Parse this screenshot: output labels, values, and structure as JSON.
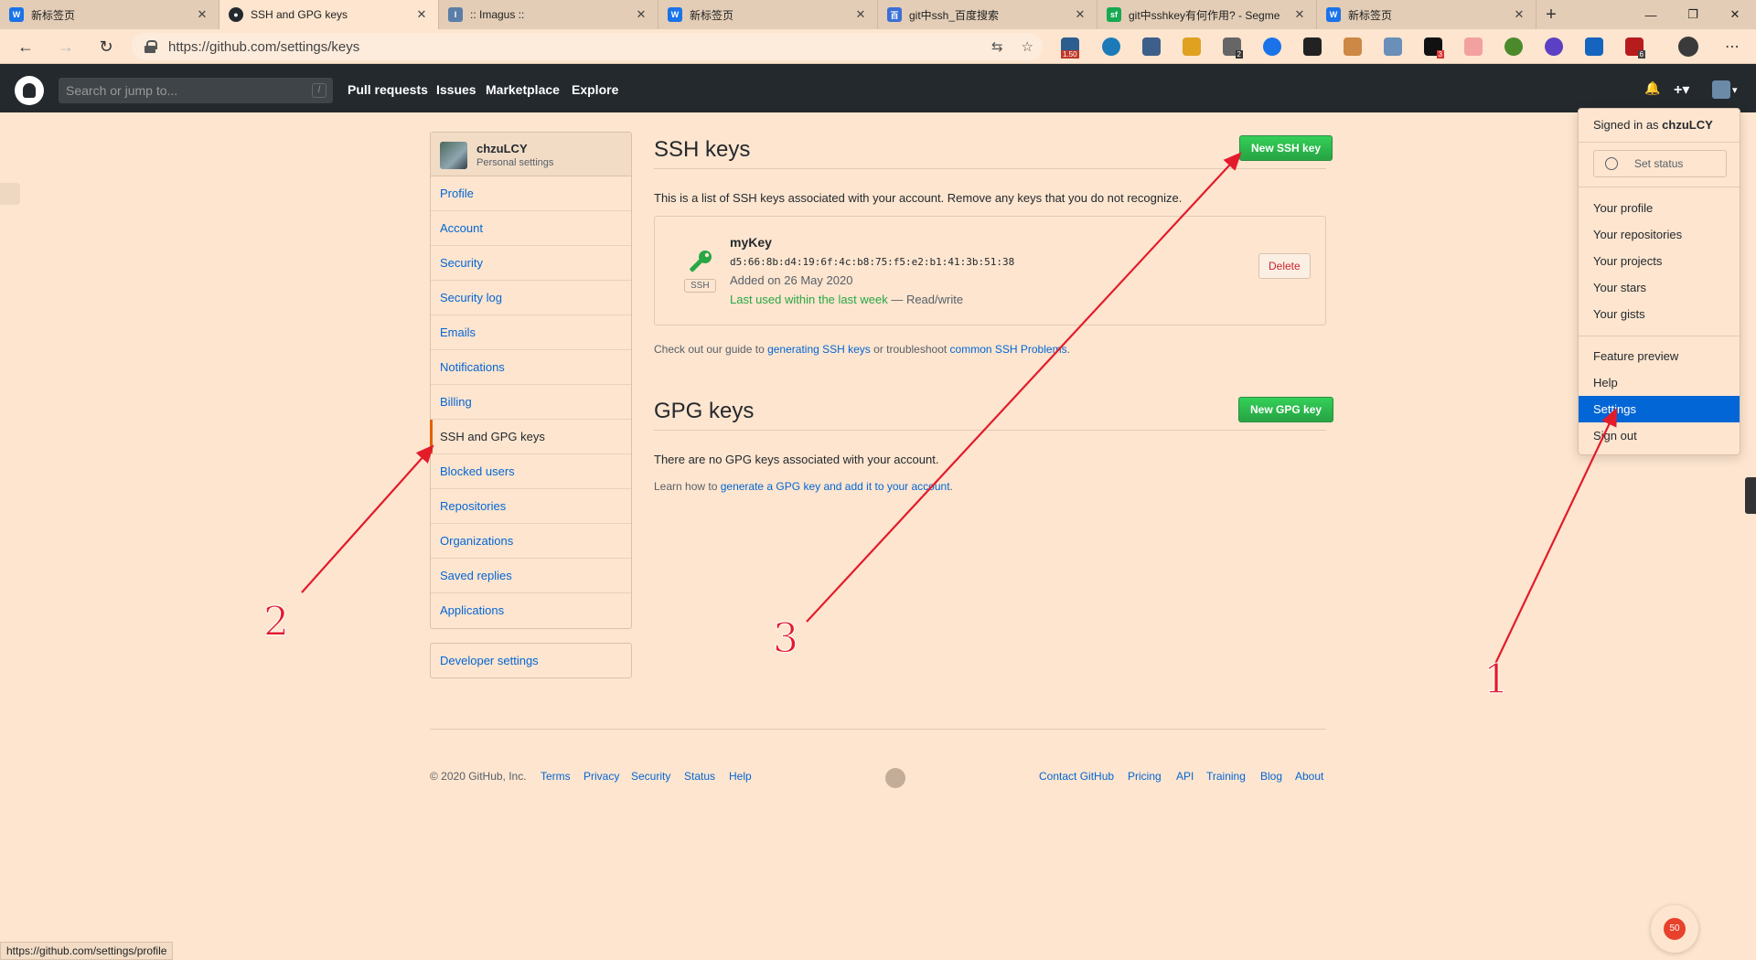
{
  "browser": {
    "tabs": [
      {
        "title": "新标签页",
        "icon_color": "#1a73e8",
        "icon_text": "W"
      },
      {
        "title": "SSH and GPG keys",
        "icon_color": "#24292e",
        "icon_text": "●"
      },
      {
        "title": ":: Imagus ::",
        "icon_color": "#5a7ea8",
        "icon_text": "I"
      },
      {
        "title": "新标签页",
        "icon_color": "#1a73e8",
        "icon_text": "W"
      },
      {
        "title": "git中ssh_百度搜索",
        "icon_color": "#3b6fd6",
        "icon_text": "百"
      },
      {
        "title": "git中sshkey有何作用? - Segme",
        "icon_color": "#16a951",
        "icon_text": "sf"
      },
      {
        "title": "新标签页",
        "icon_color": "#1a73e8",
        "icon_text": "W"
      }
    ],
    "tab_close": "✕",
    "new_tab": "+",
    "window_controls": {
      "minimize": "—",
      "maximize": "❐",
      "close": "✕"
    },
    "nav": {
      "back": "←",
      "forward": "→",
      "refresh": "↻"
    },
    "url": "https://github.com/settings/keys",
    "url_icons": [
      "translate-icon",
      "star-icon"
    ],
    "extension_badges": [
      "1.50",
      "2",
      "3",
      "6"
    ],
    "status_url": "https://github.com/settings/profile"
  },
  "github": {
    "search_placeholder": "Search or jump to...",
    "search_shortcut": "/",
    "nav": [
      "Pull requests",
      "Issues",
      "Marketplace",
      "Explore"
    ],
    "header_icons": {
      "bell": "🔔",
      "plus": "+▾",
      "caret": "▾"
    },
    "sidebar": {
      "username": "chzuLCY",
      "subtitle": "Personal settings",
      "items": [
        "Profile",
        "Account",
        "Security",
        "Security log",
        "Emails",
        "Notifications",
        "Billing",
        "SSH and GPG keys",
        "Blocked users",
        "Repositories",
        "Organizations",
        "Saved replies",
        "Applications"
      ],
      "selected_index": 7,
      "developer_settings": "Developer settings"
    },
    "ssh": {
      "title": "SSH keys",
      "new_button": "New SSH key",
      "description": "This is a list of SSH keys associated with your account. Remove any keys that you do not recognize.",
      "key": {
        "name": "myKey",
        "fingerprint": "d5:66:8b:d4:19:6f:4c:b8:75:f5:e2:b1:41:3b:51:38",
        "added": "Added on 26 May 2020",
        "last_used": "Last used within the last week",
        "access": " — Read/write",
        "badge": "SSH",
        "delete_button": "Delete"
      },
      "guide_prefix": "Check out our guide to ",
      "guide_link1": "generating SSH keys",
      "guide_middle": " or troubleshoot ",
      "guide_link2": "common SSH Problems",
      "guide_suffix": "."
    },
    "gpg": {
      "title": "GPG keys",
      "new_button": "New GPG key",
      "empty": "There are no GPG keys associated with your account.",
      "learn_prefix": "Learn how to ",
      "learn_link": "generate a GPG key and add it to your account",
      "learn_suffix": "."
    },
    "footer": {
      "copyright": "© 2020 GitHub, Inc.",
      "left_links": [
        "Terms",
        "Privacy",
        "Security",
        "Status",
        "Help"
      ],
      "right_links": [
        "Contact GitHub",
        "Pricing",
        "API",
        "Training",
        "Blog",
        "About"
      ]
    },
    "dropdown": {
      "signed_in_prefix": "Signed in as ",
      "signed_in_user": "chzuLCY",
      "set_status": "Set status",
      "group1": [
        "Your profile",
        "Your repositories",
        "Your projects",
        "Your stars",
        "Your gists"
      ],
      "group2": [
        "Feature preview",
        "Help",
        "Settings",
        "Sign out"
      ],
      "highlighted": "Settings"
    }
  },
  "annotations": {
    "numbers": [
      "1",
      "2",
      "3"
    ],
    "color": "#e31b2b"
  },
  "fab_badge": "50"
}
